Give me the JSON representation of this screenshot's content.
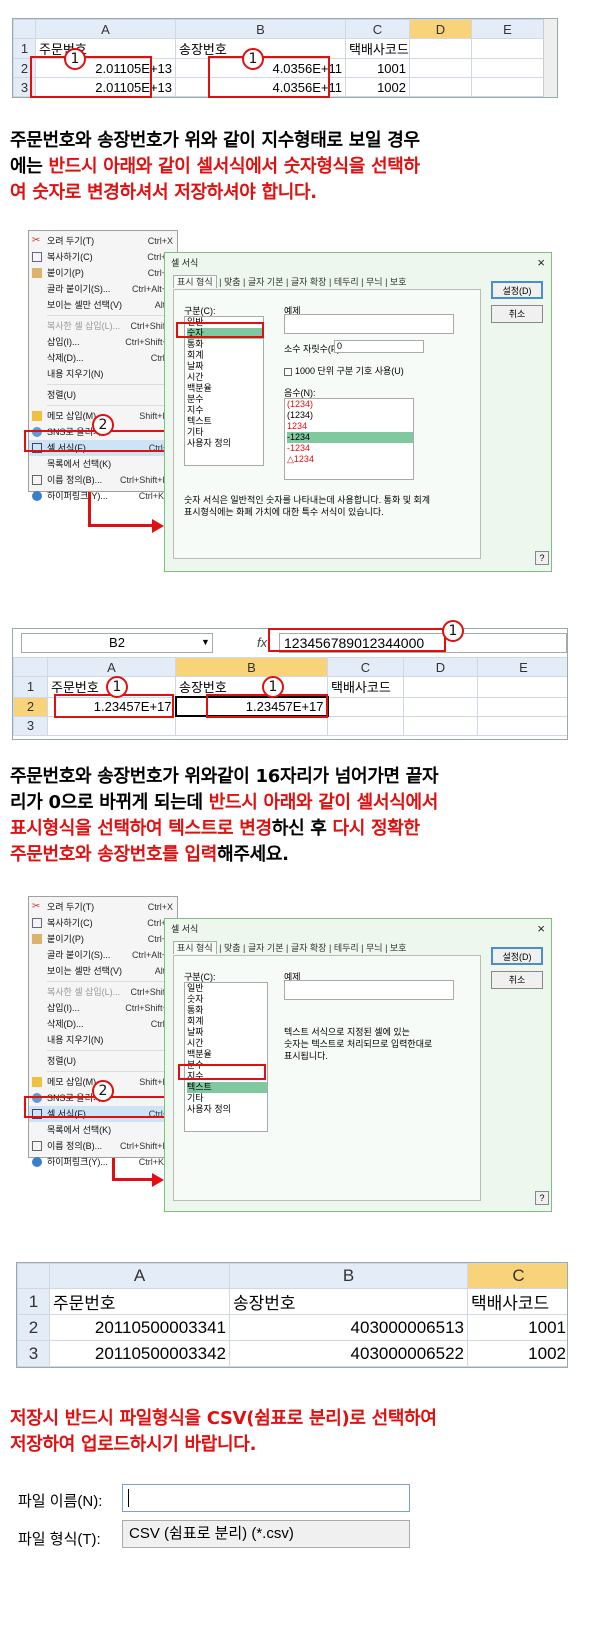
{
  "sheet1": {
    "cols": [
      "A",
      "B",
      "C",
      "D",
      "E"
    ],
    "rows": [
      {
        "n": "1",
        "a": "주문번호",
        "b": "송장번호",
        "c": "택배사코드"
      },
      {
        "n": "2",
        "a": "2.01105E+13",
        "b": "4.0356E+11",
        "c": "1001"
      },
      {
        "n": "3",
        "a": "2.01105E+13",
        "b": "4.0356E+11",
        "c": "1002"
      }
    ]
  },
  "marker": "1",
  "marker2": "2",
  "para1": {
    "line1": "주문번호와 송장번호가 위와 같이 지수형태로 보일 경우",
    "line2a": "에는 ",
    "line2b": "반드시 아래와 같이 셀서식에서 숫자형식을 선택하",
    "line3": "여 숫자로 변경하셔서 저장하셔야 합니다."
  },
  "menu": {
    "items": [
      {
        "label": "오려 두기(T)",
        "sc": "Ctrl+X"
      },
      {
        "label": "복사하기(C)",
        "sc": "Ctrl+C"
      },
      {
        "label": "붙이기(P)",
        "sc": "Ctrl+V"
      },
      {
        "label": "골라 붙이기(S)...",
        "sc": "Ctrl+Alt+V"
      },
      {
        "label": "보이는 셀만 선택(V)",
        "sc": "Alt+;"
      },
      {
        "label": "복사한 셀 삽입(L)...",
        "sc": "Ctrl+Shift+"
      },
      {
        "label": "삽입(I)...",
        "sc": "Ctrl+Shift+="
      },
      {
        "label": "삭제(D)...",
        "sc": "Ctrl+-"
      },
      {
        "label": "내용 지우기(N)",
        "sc": ""
      },
      {
        "label": "정렬(U)",
        "sc": ""
      },
      {
        "label": "메모 삽입(M)",
        "sc": "Shift+F2"
      },
      {
        "label": "SNS로 올리기",
        "sc": ""
      },
      {
        "label": "셀 서식(F)...",
        "sc": "Ctrl+1"
      },
      {
        "label": "목록에서 선택(K)",
        "sc": ""
      },
      {
        "label": "이름 정의(B)...",
        "sc": "Ctrl+Shift+F3"
      },
      {
        "label": "하이퍼링크(Y)...",
        "sc": "Ctrl+K,H"
      }
    ]
  },
  "dialog": {
    "title": "셀 서식",
    "close": "×",
    "tabs": [
      "표시 형식",
      "맞춤",
      "글자 기본",
      "글자 확장",
      "테두리",
      "무늬",
      "보호"
    ],
    "category_label": "구분(C):",
    "categories": [
      "일반",
      "숫자",
      "통화",
      "회계",
      "날짜",
      "시간",
      "백분율",
      "분수",
      "지수",
      "텍스트",
      "기타",
      "사용자 정의"
    ],
    "example_label": "예제",
    "decimal_label": "소수 자릿수(P):",
    "decimal_value": "0",
    "thousands_label": "1000 단위 구분 기호 사용(U)",
    "negative_label": "음수(N):",
    "negatives": [
      "(1234)",
      "(1234)",
      "1234",
      "-1234",
      "-1234",
      "△1234"
    ],
    "desc_number_1": "숫자 서식은 일반적인 숫자를 나타내는데 사용합니다. 통화 및 회계",
    "desc_number_2": "표시형식에는 화폐 가치에 대한 특수 서식이 있습니다.",
    "desc_text_1": "텍스트 서식으로 지정된 셀에 있는",
    "desc_text_2": "숫자는 텍스트로 처리되므로 입력한대로",
    "desc_text_3": "표시됩니다.",
    "ok": "설정(D)",
    "cancel": "취소",
    "help": "?"
  },
  "sheet2": {
    "namebox": "B2",
    "fx": "fx",
    "formula": "123456789012344000",
    "cols": [
      "A",
      "B",
      "C",
      "D",
      "E"
    ],
    "rows": [
      {
        "n": "1",
        "a": "주문번호",
        "b": "송장번호",
        "c": "택배사코드"
      },
      {
        "n": "2",
        "a": "1.23457E+17",
        "b": "1.23457E+17",
        "c": ""
      },
      {
        "n": "3",
        "a": "",
        "b": "",
        "c": ""
      }
    ]
  },
  "para2": {
    "line1": "주문번호와 송장번호가 위와같이 16자리가 넘어가면 끝자",
    "line2a": "리가 0으로 바뀌게 되는데 ",
    "line2b": "반드시 아래와 같이 셀서식에서",
    "line3a": "표시형식을 선택하여 텍스트로 변경",
    "line3b": "하신 후 ",
    "line3c": "다시 정확한",
    "line4a": "주문번호와 송장번호를 입력",
    "line4b": "해주세요."
  },
  "sheet3": {
    "cols": [
      "A",
      "B",
      "C"
    ],
    "rows": [
      {
        "n": "1",
        "a": "주문번호",
        "b": "송장번호",
        "c": "택배사코드"
      },
      {
        "n": "2",
        "a": "20110500003341",
        "b": "403000006513",
        "c": "1001"
      },
      {
        "n": "3",
        "a": "20110500003342",
        "b": "403000006522",
        "c": "1002"
      }
    ]
  },
  "para3": {
    "line1": "저장시 반드시 파일형식을 CSV(쉼표로 분리)로 선택하여",
    "line2": "저장하여 업로드하시기 바랍니다."
  },
  "save": {
    "name_label": "파일 이름(N):",
    "name_value": "",
    "type_label": "파일 형식(T):",
    "type_value": "CSV (쉼표로 분리) (*.csv)"
  },
  "colors": {
    "red": "#e01010",
    "sel_col": "#f9d37a",
    "header": "#e4ecf7"
  }
}
